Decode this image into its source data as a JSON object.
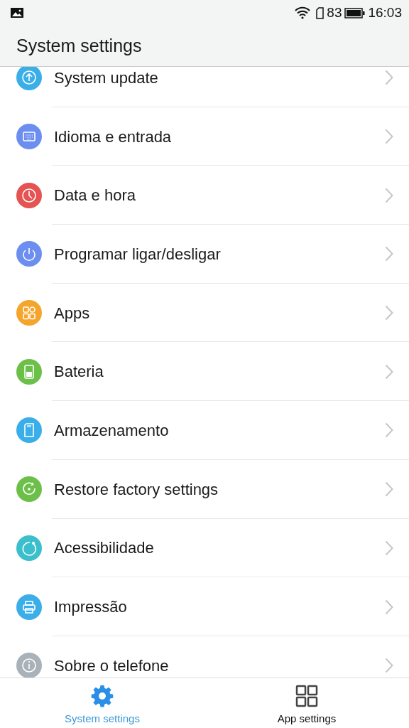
{
  "status_bar": {
    "battery_text": "83",
    "time": "16:03"
  },
  "header": {
    "title": "System settings"
  },
  "items": [
    {
      "label": "System update",
      "color": "#3aaee8"
    },
    {
      "label": "Idioma e entrada",
      "color": "#6b8ef0"
    },
    {
      "label": "Data e hora",
      "color": "#e55353"
    },
    {
      "label": "Programar ligar/desligar",
      "color": "#6b8ef0"
    },
    {
      "label": "Apps",
      "color": "#f5a42c"
    },
    {
      "label": "Bateria",
      "color": "#6cc04a"
    },
    {
      "label": "Armazenamento",
      "color": "#3aaee8"
    },
    {
      "label": "Restore factory settings",
      "color": "#6cc04a"
    },
    {
      "label": "Acessibilidade",
      "color": "#3bbfcc"
    },
    {
      "label": "Impressão",
      "color": "#3aaee8"
    },
    {
      "label": "Sobre o telefone",
      "color": "#a9b2b9"
    }
  ],
  "tabs": [
    {
      "label": "System settings",
      "selected": true
    },
    {
      "label": "App settings",
      "selected": false
    }
  ]
}
